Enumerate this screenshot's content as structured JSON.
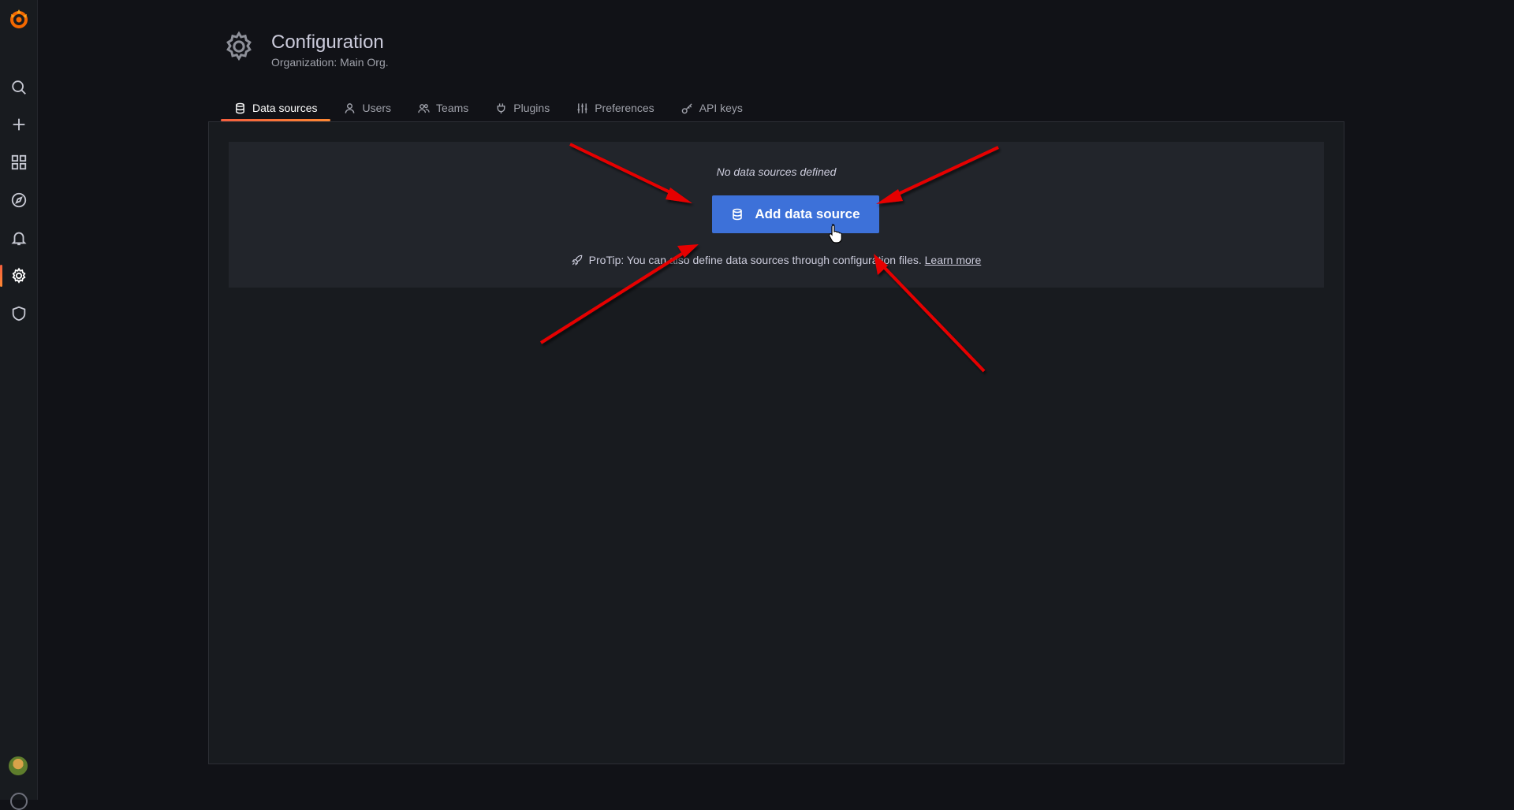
{
  "app": {
    "name": "Grafana",
    "brand_color": "#f46800",
    "accent_gradient": [
      "#f55f3e",
      "#ff8833"
    ],
    "primary_button_color": "#3d71d9"
  },
  "sidebar": {
    "items": [
      {
        "name": "search",
        "icon": "search-icon"
      },
      {
        "name": "create",
        "icon": "plus-icon"
      },
      {
        "name": "dashboards",
        "icon": "apps-icon"
      },
      {
        "name": "explore",
        "icon": "compass-icon"
      },
      {
        "name": "alerting",
        "icon": "bell-icon"
      },
      {
        "name": "configuration",
        "icon": "gear-icon",
        "active": true
      },
      {
        "name": "server-admin",
        "icon": "shield-icon"
      }
    ]
  },
  "header": {
    "title": "Configuration",
    "subtitle": "Organization: Main Org.",
    "icon": "gear-icon"
  },
  "tabs": [
    {
      "label": "Data sources",
      "icon": "database-icon",
      "active": true
    },
    {
      "label": "Users",
      "icon": "user-icon"
    },
    {
      "label": "Teams",
      "icon": "users-icon"
    },
    {
      "label": "Plugins",
      "icon": "plug-icon"
    },
    {
      "label": "Preferences",
      "icon": "sliders-icon"
    },
    {
      "label": "API keys",
      "icon": "key-icon"
    }
  ],
  "empty_state": {
    "title": "No data sources defined",
    "button_label": "Add data source",
    "button_icon": "database-icon",
    "protip_text": "ProTip: You can also define data sources through configuration files.",
    "protip_link": "Learn more",
    "protip_icon": "rocket-icon"
  },
  "annotations": {
    "arrow_color": "#e60000",
    "arrow_count": 4
  }
}
